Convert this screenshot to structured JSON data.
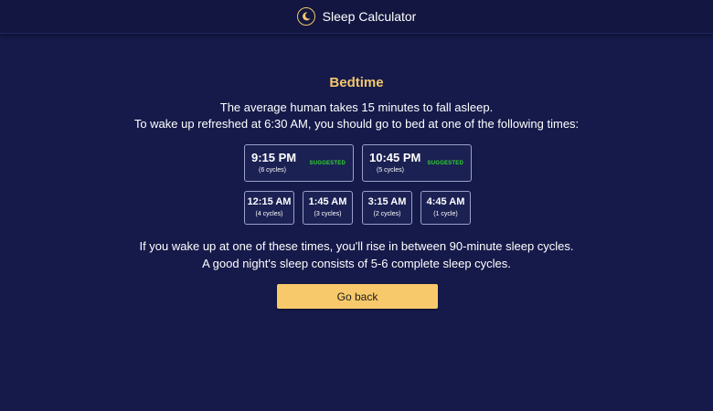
{
  "header": {
    "title": "Sleep Calculator",
    "logo_icon": "crescent-moon-icon",
    "accent_color": "#f3c76a"
  },
  "main": {
    "heading": "Bedtime",
    "intro_line1": "The average human takes 15 minutes to fall asleep.",
    "intro_line2": "To wake up refreshed at 6:30 AM, you should go to bed at one of the following times:",
    "suggested_times": [
      {
        "time": "9:15 PM",
        "cycles": "(6 cycles)",
        "badge": "SUGGESTED"
      },
      {
        "time": "10:45 PM",
        "cycles": "(5 cycles)",
        "badge": "SUGGESTED"
      }
    ],
    "other_times": [
      {
        "time": "12:15 AM",
        "cycles": "(4 cycles)"
      },
      {
        "time": "1:45 AM",
        "cycles": "(3 cycles)"
      },
      {
        "time": "3:15 AM",
        "cycles": "(2 cycles)"
      },
      {
        "time": "4:45 AM",
        "cycles": "(1 cycle)"
      }
    ],
    "footer_line1": "If you wake up at one of these times, you'll rise in between 90-minute sleep cycles.",
    "footer_line2": "A good night's sleep consists of 5-6 complete sleep cycles.",
    "back_button": "Go back",
    "badge_color": "#2fd62f"
  }
}
